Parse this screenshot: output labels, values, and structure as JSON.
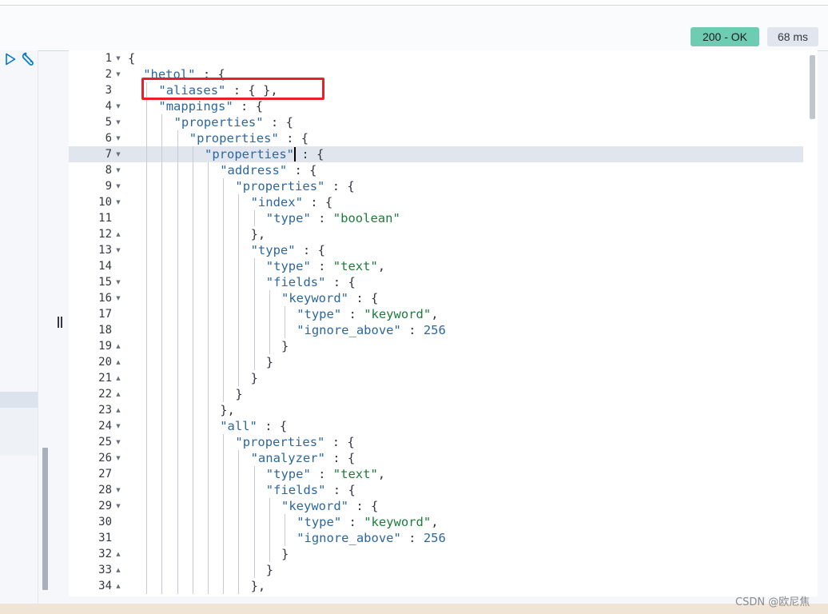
{
  "response": {
    "status": "200 - OK",
    "time": "68 ms"
  },
  "colors": {
    "status_ok": "#6dccb1",
    "highlight": "#e8202a",
    "key": "#2c67a0",
    "string": "#1b7d3a"
  },
  "icons": {
    "run": "play-icon",
    "settings": "wrench-icon"
  },
  "active_line": 7,
  "lines": [
    {
      "n": "1",
      "fold": "down",
      "ind": 0,
      "key": "",
      "p": "{"
    },
    {
      "n": "2",
      "fold": "down",
      "ind": 1,
      "key": "\"hetol\"",
      "p": " : {"
    },
    {
      "n": "3",
      "fold": "",
      "ind": 2,
      "key": "\"aliases\"",
      "p": " : { },"
    },
    {
      "n": "4",
      "fold": "down",
      "ind": 2,
      "key": "\"mappings\"",
      "p": " : {"
    },
    {
      "n": "5",
      "fold": "down",
      "ind": 3,
      "key": "\"properties\"",
      "p": " : {"
    },
    {
      "n": "6",
      "fold": "down",
      "ind": 4,
      "key": "\"properties\"",
      "p": " : {"
    },
    {
      "n": "7",
      "fold": "down",
      "ind": 5,
      "key": "\"properties\"",
      "p": " : {"
    },
    {
      "n": "8",
      "fold": "down",
      "ind": 6,
      "key": "\"address\"",
      "p": " : {"
    },
    {
      "n": "9",
      "fold": "down",
      "ind": 7,
      "key": "\"properties\"",
      "p": " : {"
    },
    {
      "n": "10",
      "fold": "down",
      "ind": 8,
      "key": "\"index\"",
      "p": " : {"
    },
    {
      "n": "11",
      "fold": "",
      "ind": 9,
      "key": "\"type\"",
      "p": " : ",
      "val": "\"boolean\""
    },
    {
      "n": "12",
      "fold": "up",
      "ind": 8,
      "key": "",
      "p": "},"
    },
    {
      "n": "13",
      "fold": "down",
      "ind": 8,
      "key": "\"type\"",
      "p": " : {"
    },
    {
      "n": "14",
      "fold": "",
      "ind": 9,
      "key": "\"type\"",
      "p": " : ",
      "val": "\"text\"",
      "tail": ","
    },
    {
      "n": "15",
      "fold": "down",
      "ind": 9,
      "key": "\"fields\"",
      "p": " : {"
    },
    {
      "n": "16",
      "fold": "down",
      "ind": 10,
      "key": "\"keyword\"",
      "p": " : {"
    },
    {
      "n": "17",
      "fold": "",
      "ind": 11,
      "key": "\"type\"",
      "p": " : ",
      "val": "\"keyword\"",
      "tail": ","
    },
    {
      "n": "18",
      "fold": "",
      "ind": 11,
      "key": "\"ignore_above\"",
      "p": " : ",
      "num": "256"
    },
    {
      "n": "19",
      "fold": "up",
      "ind": 10,
      "key": "",
      "p": "}"
    },
    {
      "n": "20",
      "fold": "up",
      "ind": 9,
      "key": "",
      "p": "}"
    },
    {
      "n": "21",
      "fold": "up",
      "ind": 8,
      "key": "",
      "p": "}"
    },
    {
      "n": "22",
      "fold": "up",
      "ind": 7,
      "key": "",
      "p": "}"
    },
    {
      "n": "23",
      "fold": "up",
      "ind": 6,
      "key": "",
      "p": "},"
    },
    {
      "n": "24",
      "fold": "down",
      "ind": 6,
      "key": "\"all\"",
      "p": " : {"
    },
    {
      "n": "25",
      "fold": "down",
      "ind": 7,
      "key": "\"properties\"",
      "p": " : {"
    },
    {
      "n": "26",
      "fold": "down",
      "ind": 8,
      "key": "\"analyzer\"",
      "p": " : {"
    },
    {
      "n": "27",
      "fold": "",
      "ind": 9,
      "key": "\"type\"",
      "p": " : ",
      "val": "\"text\"",
      "tail": ","
    },
    {
      "n": "28",
      "fold": "down",
      "ind": 9,
      "key": "\"fields\"",
      "p": " : {"
    },
    {
      "n": "29",
      "fold": "down",
      "ind": 10,
      "key": "\"keyword\"",
      "p": " : {"
    },
    {
      "n": "30",
      "fold": "",
      "ind": 11,
      "key": "\"type\"",
      "p": " : ",
      "val": "\"keyword\"",
      "tail": ","
    },
    {
      "n": "31",
      "fold": "",
      "ind": 11,
      "key": "\"ignore_above\"",
      "p": " : ",
      "num": "256"
    },
    {
      "n": "32",
      "fold": "up",
      "ind": 10,
      "key": "",
      "p": "}"
    },
    {
      "n": "33",
      "fold": "up",
      "ind": 9,
      "key": "",
      "p": "}"
    },
    {
      "n": "34",
      "fold": "up",
      "ind": 8,
      "key": "",
      "p": "},"
    }
  ],
  "watermark": "CSDN @欧尼焦"
}
